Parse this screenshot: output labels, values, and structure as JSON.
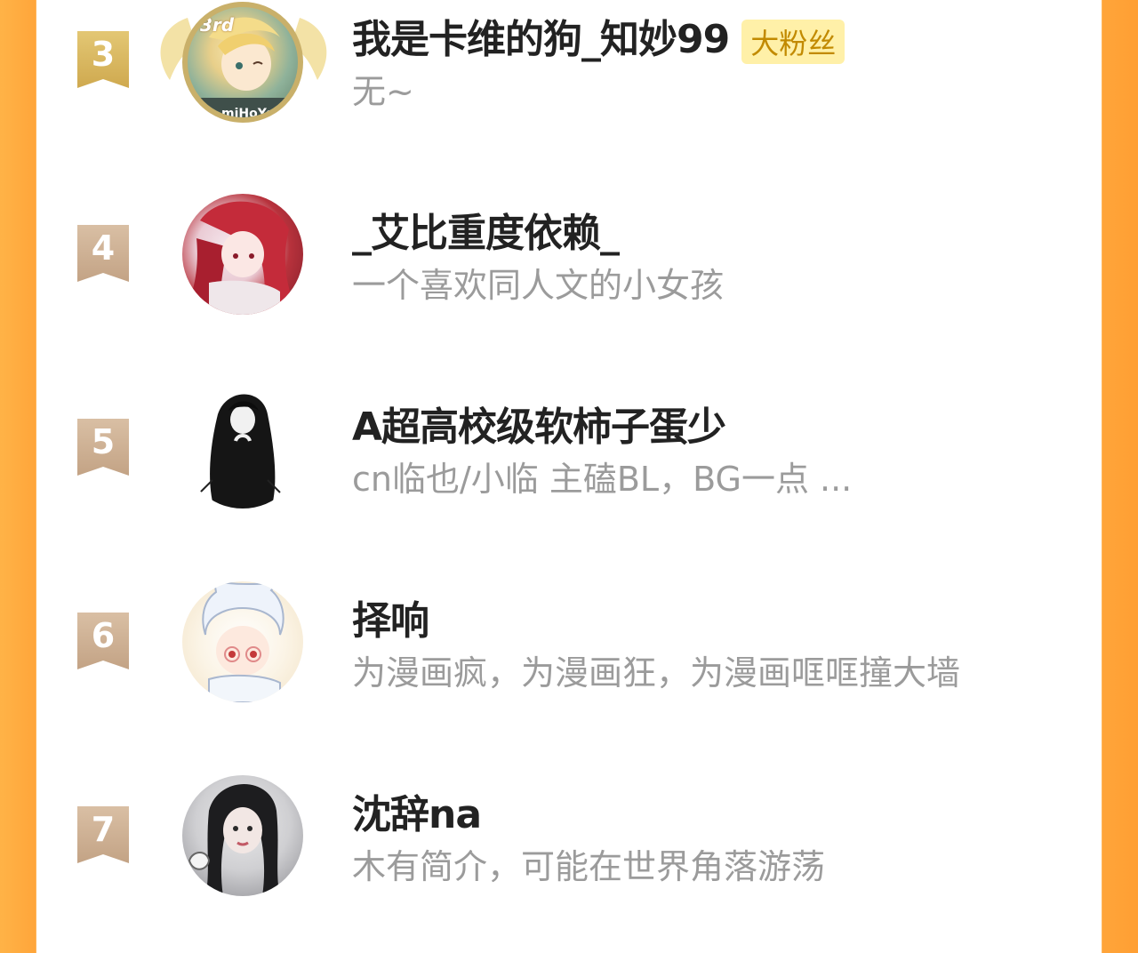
{
  "colors": {
    "side_bg": "#ffa53a",
    "rank_top3": "#d6b45a",
    "rank_other": "#c8aa8c",
    "badge_bg": "#fff0a8",
    "badge_text": "#c28a00",
    "name_text": "#222222",
    "bio_text": "#9b9b9b"
  },
  "fans": [
    {
      "rank": "3",
      "name": "我是卡维的狗_知妙99",
      "badge": "大粉丝",
      "bio": "无~",
      "avatar_label": "3rd",
      "avatar_watermark": "miHoYo"
    },
    {
      "rank": "4",
      "name": "_艾比重度依赖_",
      "bio": "一个喜欢同人文的小女孩"
    },
    {
      "rank": "5",
      "name": "A超高校级软柿子蛋少",
      "bio": "cn临也/小临 主磕BL，BG一点 ..."
    },
    {
      "rank": "6",
      "name": "择响",
      "bio": "为漫画疯，为漫画狂，为漫画哐哐撞大墙"
    },
    {
      "rank": "7",
      "name": "沈辞na",
      "bio": "木有简介，可能在世界角落游荡"
    }
  ]
}
